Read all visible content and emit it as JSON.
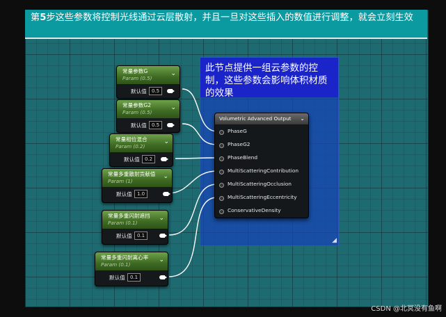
{
  "banner": {
    "step_prefix": "第",
    "step_number": "5",
    "step_text": "步这些参数将控制光线通过云层散射，并且一旦对这些插入的数值进行调整，就会立刻生效"
  },
  "comment": {
    "text": "此节点提供一组云参数的控制，这些参数会影响体积材质的效果"
  },
  "param_nodes": [
    {
      "title": "常量参数G",
      "subtitle": "Param (0.5)",
      "label": "默认值",
      "value": "0.5"
    },
    {
      "title": "常量参数G2",
      "subtitle": "Param (0.5)",
      "label": "默认值",
      "value": "0.5"
    },
    {
      "title": "常量相位混合",
      "subtitle": "Param (0.2)",
      "label": "默认值",
      "value": "0.2"
    },
    {
      "title": "常量多重散射贡献值",
      "subtitle": "Param (1)",
      "label": "默认值",
      "value": "1.0"
    },
    {
      "title": "常量多重闪射遮挡",
      "subtitle": "Param (0.1)",
      "label": "默认值",
      "value": "0.1"
    },
    {
      "title": "常量多重闪射离心率",
      "subtitle": "Param (0.1)",
      "label": "默认值",
      "value": "0.1"
    }
  ],
  "volumetric_node": {
    "title": "Volumetric Advanced Output",
    "inputs": [
      "PhaseG",
      "PhaseG2",
      "PhaseBlend",
      "MultiScatteringContribution",
      "MultiScatteringOcclusion",
      "MultiScatteringEccentricity",
      "ConservativeDensity"
    ]
  },
  "watermark": "CSDN @北冥没有鱼啊",
  "colors": {
    "canvas": "#1d6a70",
    "banner": "#0b9aa0",
    "comment_head": "#1a24c8",
    "param_header": "#4e8a2e"
  }
}
